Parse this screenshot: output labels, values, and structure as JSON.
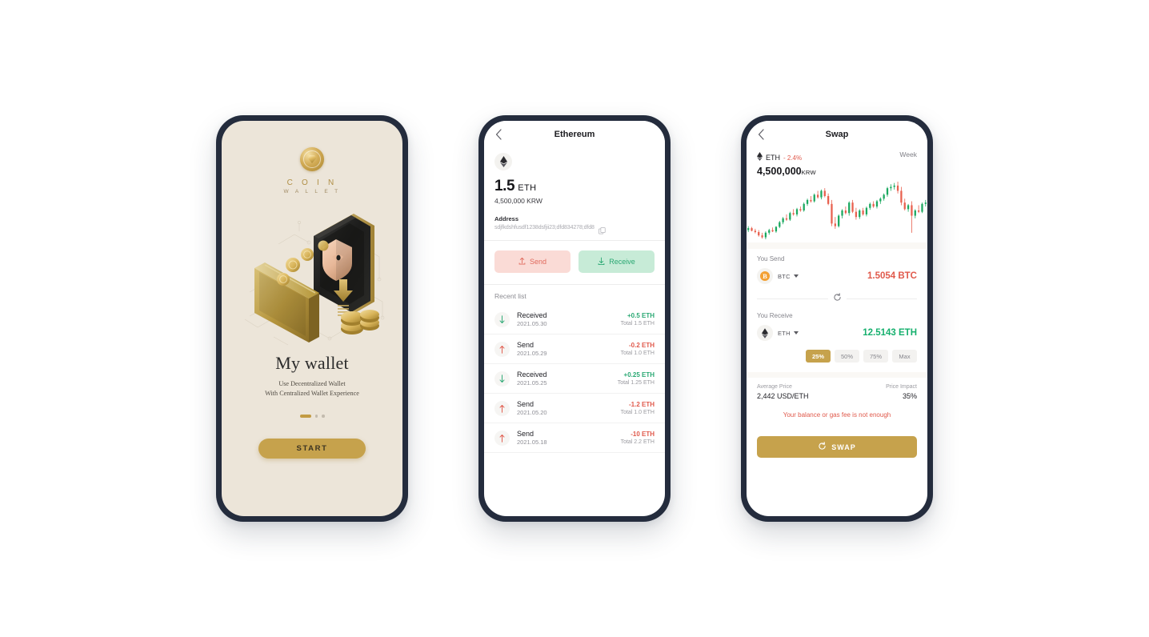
{
  "screen_onboarding": {
    "logo": {
      "brand_line1": "C O I N",
      "brand_line2": "W A L L E T",
      "icon": "coin-gem-logo"
    },
    "title": "My wallet",
    "subtitle_line1": "Use Decentralized Wallet",
    "subtitle_line2": "With Centralized Wallet Experience",
    "pagination": {
      "active_index": 0,
      "count": 3
    },
    "start_label": "START",
    "bg_color": "#ece5d9",
    "accent_gold": "#c6a24c"
  },
  "screen_ethereum": {
    "header": {
      "title": "Ethereum",
      "back_icon": "chevron-left-icon"
    },
    "token_icon": "ethereum-icon",
    "balance_amount": "1.5",
    "balance_unit": "ETH",
    "balance_fiat": "4,500,000 KRW",
    "address_label": "Address",
    "address_value": "sdjfkdshfusdf1238dsfjii23;dfd834278;dfd8",
    "copy_icon": "copy-icon",
    "send_label": "Send",
    "receive_label": "Receive",
    "send_icon": "upload-arrow-icon",
    "receive_icon": "download-arrow-icon",
    "send_bg": "#fadbd6",
    "receive_bg": "#c7ebd7",
    "recent_list_label": "Recent list",
    "transactions": [
      {
        "type": "Received",
        "date": "2021.05.30",
        "amount": "+0.5 ETH",
        "total": "Total 1.5 ETH",
        "direction": "in",
        "icon": "arrow-down-icon"
      },
      {
        "type": "Send",
        "date": "2021.05.29",
        "amount": "-0.2 ETH",
        "total": "Total 1.0 ETH",
        "direction": "out",
        "icon": "arrow-up-icon"
      },
      {
        "type": "Received",
        "date": "2021.05.25",
        "amount": "+0.25 ETH",
        "total": "Total 1.25 ETH",
        "direction": "in",
        "icon": "arrow-down-icon"
      },
      {
        "type": "Send",
        "date": "2021.05.20",
        "amount": "-1.2 ETH",
        "total": "Total 1.0 ETH",
        "direction": "out",
        "icon": "arrow-up-icon"
      },
      {
        "type": "Send",
        "date": "2021.05.18",
        "amount": "-10 ETH",
        "total": "Total 2.2 ETH",
        "direction": "out",
        "icon": "arrow-up-icon"
      }
    ]
  },
  "screen_swap": {
    "header": {
      "title": "Swap",
      "back_icon": "chevron-left-icon"
    },
    "chart": {
      "symbol": "ETH",
      "change": "- 2.4%",
      "range_label": "Week",
      "price": "4,500,000",
      "price_unit": "KRW",
      "symbol_icon": "ethereum-icon"
    },
    "you_send": {
      "label": "You Send",
      "token": "BTC",
      "token_icon": "bitcoin-icon",
      "amount": "1.5054 BTC",
      "color": "#e0594b"
    },
    "swap_toggle_icon": "refresh-icon",
    "you_receive": {
      "label": "You Receive",
      "token": "ETH",
      "token_icon": "ethereum-icon",
      "amount": "12.5143 ETH",
      "color": "#16b06e"
    },
    "percent_options": [
      {
        "label": "25%",
        "selected": true
      },
      {
        "label": "50%",
        "selected": false
      },
      {
        "label": "75%",
        "selected": false
      },
      {
        "label": "Max",
        "selected": false
      }
    ],
    "average_price_label": "Average Price",
    "average_price_value": "2,442 USD/ETH",
    "price_impact_label": "Price Impact",
    "price_impact_value": "35%",
    "warning": "Your balance or gas fee is not enough",
    "swap_button_label": "SWAP",
    "swap_button_icon": "refresh-icon",
    "accent_gold": "#c6a24c"
  },
  "chart_data": {
    "type": "candlestick",
    "title": "ETH price",
    "xlabel": "",
    "ylabel": "KRW",
    "range": "Week",
    "up_color": "#1aa85f",
    "down_color": "#e8604e",
    "candles": [
      {
        "o": 24,
        "h": 30,
        "l": 21,
        "c": 27,
        "dir": "up"
      },
      {
        "o": 27,
        "h": 29,
        "l": 22,
        "c": 23,
        "dir": "down"
      },
      {
        "o": 23,
        "h": 26,
        "l": 19,
        "c": 21,
        "dir": "down"
      },
      {
        "o": 21,
        "h": 24,
        "l": 14,
        "c": 16,
        "dir": "down"
      },
      {
        "o": 16,
        "h": 20,
        "l": 11,
        "c": 13,
        "dir": "down"
      },
      {
        "o": 13,
        "h": 22,
        "l": 10,
        "c": 20,
        "dir": "up"
      },
      {
        "o": 20,
        "h": 26,
        "l": 17,
        "c": 24,
        "dir": "up"
      },
      {
        "o": 24,
        "h": 28,
        "l": 21,
        "c": 22,
        "dir": "down"
      },
      {
        "o": 22,
        "h": 30,
        "l": 20,
        "c": 29,
        "dir": "up"
      },
      {
        "o": 29,
        "h": 38,
        "l": 27,
        "c": 36,
        "dir": "up"
      },
      {
        "o": 36,
        "h": 44,
        "l": 33,
        "c": 42,
        "dir": "up"
      },
      {
        "o": 42,
        "h": 48,
        "l": 38,
        "c": 40,
        "dir": "down"
      },
      {
        "o": 40,
        "h": 52,
        "l": 38,
        "c": 50,
        "dir": "up"
      },
      {
        "o": 50,
        "h": 56,
        "l": 46,
        "c": 48,
        "dir": "down"
      },
      {
        "o": 48,
        "h": 58,
        "l": 45,
        "c": 56,
        "dir": "up"
      },
      {
        "o": 56,
        "h": 60,
        "l": 52,
        "c": 54,
        "dir": "down"
      },
      {
        "o": 54,
        "h": 66,
        "l": 52,
        "c": 64,
        "dir": "up"
      },
      {
        "o": 64,
        "h": 72,
        "l": 61,
        "c": 70,
        "dir": "up"
      },
      {
        "o": 70,
        "h": 76,
        "l": 66,
        "c": 68,
        "dir": "down"
      },
      {
        "o": 68,
        "h": 80,
        "l": 66,
        "c": 78,
        "dir": "up"
      },
      {
        "o": 78,
        "h": 84,
        "l": 72,
        "c": 74,
        "dir": "down"
      },
      {
        "o": 74,
        "h": 86,
        "l": 71,
        "c": 84,
        "dir": "up"
      },
      {
        "o": 84,
        "h": 88,
        "l": 74,
        "c": 76,
        "dir": "down"
      },
      {
        "o": 76,
        "h": 80,
        "l": 62,
        "c": 64,
        "dir": "down"
      },
      {
        "o": 64,
        "h": 70,
        "l": 30,
        "c": 34,
        "dir": "down"
      },
      {
        "o": 34,
        "h": 44,
        "l": 26,
        "c": 30,
        "dir": "down"
      },
      {
        "o": 30,
        "h": 48,
        "l": 28,
        "c": 46,
        "dir": "up"
      },
      {
        "o": 46,
        "h": 56,
        "l": 42,
        "c": 54,
        "dir": "up"
      },
      {
        "o": 54,
        "h": 60,
        "l": 48,
        "c": 50,
        "dir": "down"
      },
      {
        "o": 50,
        "h": 68,
        "l": 46,
        "c": 66,
        "dir": "up"
      },
      {
        "o": 66,
        "h": 70,
        "l": 50,
        "c": 52,
        "dir": "down"
      },
      {
        "o": 52,
        "h": 58,
        "l": 40,
        "c": 44,
        "dir": "down"
      },
      {
        "o": 44,
        "h": 56,
        "l": 41,
        "c": 54,
        "dir": "up"
      },
      {
        "o": 54,
        "h": 58,
        "l": 46,
        "c": 48,
        "dir": "down"
      },
      {
        "o": 48,
        "h": 60,
        "l": 45,
        "c": 58,
        "dir": "up"
      },
      {
        "o": 58,
        "h": 66,
        "l": 55,
        "c": 64,
        "dir": "up"
      },
      {
        "o": 64,
        "h": 68,
        "l": 58,
        "c": 60,
        "dir": "down"
      },
      {
        "o": 60,
        "h": 70,
        "l": 57,
        "c": 68,
        "dir": "up"
      },
      {
        "o": 68,
        "h": 74,
        "l": 64,
        "c": 72,
        "dir": "up"
      },
      {
        "o": 72,
        "h": 80,
        "l": 69,
        "c": 78,
        "dir": "up"
      },
      {
        "o": 78,
        "h": 90,
        "l": 75,
        "c": 88,
        "dir": "up"
      },
      {
        "o": 88,
        "h": 94,
        "l": 84,
        "c": 90,
        "dir": "up"
      },
      {
        "o": 90,
        "h": 96,
        "l": 86,
        "c": 92,
        "dir": "up"
      },
      {
        "o": 92,
        "h": 98,
        "l": 80,
        "c": 84,
        "dir": "down"
      },
      {
        "o": 84,
        "h": 90,
        "l": 62,
        "c": 66,
        "dir": "down"
      },
      {
        "o": 66,
        "h": 72,
        "l": 54,
        "c": 56,
        "dir": "down"
      },
      {
        "o": 56,
        "h": 64,
        "l": 52,
        "c": 62,
        "dir": "up"
      },
      {
        "o": 62,
        "h": 68,
        "l": 20,
        "c": 46,
        "dir": "down"
      },
      {
        "o": 46,
        "h": 56,
        "l": 42,
        "c": 54,
        "dir": "up"
      },
      {
        "o": 54,
        "h": 62,
        "l": 50,
        "c": 52,
        "dir": "down"
      },
      {
        "o": 52,
        "h": 66,
        "l": 50,
        "c": 64,
        "dir": "up"
      },
      {
        "o": 64,
        "h": 70,
        "l": 60,
        "c": 66,
        "dir": "up"
      }
    ]
  }
}
